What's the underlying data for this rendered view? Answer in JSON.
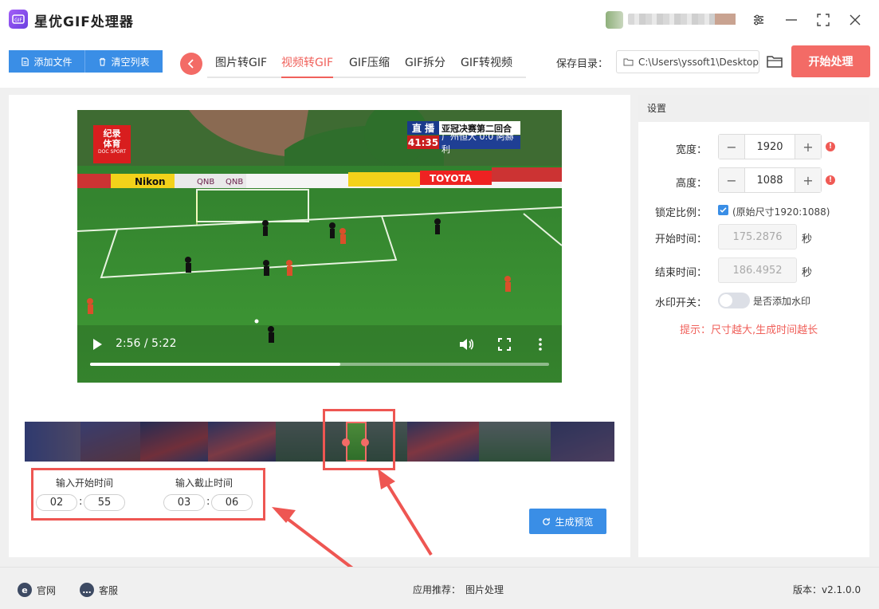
{
  "app": {
    "title": "星优GIF处理器"
  },
  "toolbar": {
    "add_files": "添加文件",
    "clear_list": "清空列表",
    "tabs": [
      {
        "label": "图片转GIF"
      },
      {
        "label": "视频转GIF",
        "active": true
      },
      {
        "label": "GIF压缩"
      },
      {
        "label": "GIF拆分"
      },
      {
        "label": "GIF转视频"
      }
    ],
    "save_dir_label": "保存目录：",
    "save_dir_value": "C:\\Users\\yssoft1\\Desktop",
    "start_button": "开始处理"
  },
  "video": {
    "time": "2:56 / 5:22",
    "progress": 0.546,
    "overlay": {
      "logo_line1": "纪录",
      "logo_line2": "体育",
      "logo_small": "DOC SPORT",
      "live_tag": "直 播",
      "live_title": "亚冠决赛第二回合",
      "clock": "41:35",
      "score": "广州恒大 0:0 阿赫利"
    },
    "ad_boards": [
      "Nikon",
      "QNB",
      "QNB",
      "TOYOTA"
    ]
  },
  "trim": {
    "start_label": "输入开始时间",
    "end_label": "输入截止时间",
    "start_min": "02",
    "start_sec": "55",
    "end_min": "03",
    "end_sec": "06",
    "separator": ":",
    "preview_button": "生成预览"
  },
  "settings": {
    "header": "设置",
    "width_label": "宽度：",
    "width_value": "1920",
    "height_label": "高度：",
    "height_value": "1088",
    "lock_label": "锁定比例：",
    "lock_checked": true,
    "lock_text": "(原始尺寸1920:1088)",
    "start_time_label": "开始时间：",
    "start_time_value": "175.2876",
    "end_time_label": "结束时间：",
    "end_time_value": "186.4952",
    "unit": "秒",
    "watermark_label": "水印开关：",
    "watermark_on": false,
    "watermark_text": "是否添加水印",
    "hint": "提示：尺寸越大,生成时间越长",
    "minus": "−",
    "plus": "+",
    "warn": "!"
  },
  "footer": {
    "website": "官网",
    "support": "客服",
    "recommend_label": "应用推荐：",
    "recommend_value": "图片处理",
    "version": "版本：v2.1.0.0"
  },
  "colors": {
    "accent_blue": "#3a8ee6",
    "accent_red": "#f36b66",
    "annotation_red": "#ee5652"
  },
  "icons": [
    "gif-logo-icon",
    "settings-icon",
    "minimize-icon",
    "maximize-icon",
    "close-icon",
    "file-add-icon",
    "trash-icon",
    "chevron-left-icon",
    "folder-icon",
    "play-icon",
    "volume-icon",
    "fullscreen-icon",
    "more-icon",
    "refresh-icon",
    "checkmark-icon",
    "ie-icon",
    "chat-icon"
  ]
}
